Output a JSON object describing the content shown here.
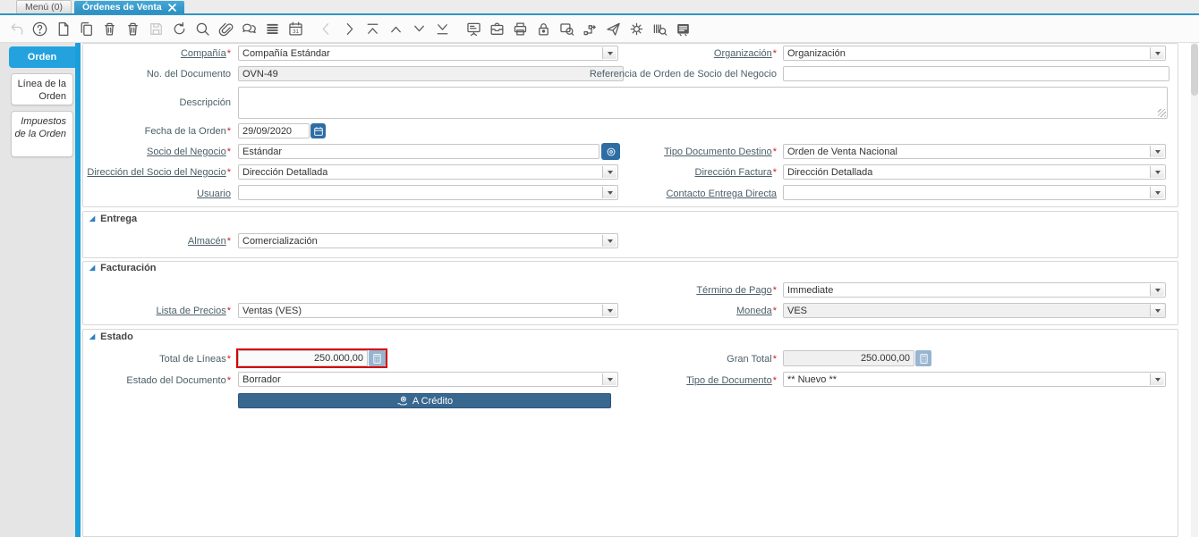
{
  "window": {
    "tab_menu": "Menú (0)",
    "tab_active": "Órdenes de Venta"
  },
  "toolbar": {
    "items": [
      {
        "name": "undo",
        "disabled": true
      },
      {
        "name": "help"
      },
      {
        "name": "new-record"
      },
      {
        "name": "copy-record"
      },
      {
        "name": "delete-record"
      },
      {
        "name": "delete-selection"
      },
      {
        "name": "save",
        "disabled": true
      },
      {
        "name": "refresh"
      },
      {
        "name": "find"
      },
      {
        "name": "attachment"
      },
      {
        "name": "chat"
      },
      {
        "name": "toggle-grid"
      },
      {
        "name": "calendar"
      },
      {
        "name": "previous-record",
        "disabled": true
      },
      {
        "name": "next-record"
      },
      {
        "name": "first-record"
      },
      {
        "name": "parent-record"
      },
      {
        "name": "detail-record"
      },
      {
        "name": "last-record"
      },
      {
        "name": "report"
      },
      {
        "name": "archive"
      },
      {
        "name": "print"
      },
      {
        "name": "lock"
      },
      {
        "name": "zoom-across"
      },
      {
        "name": "workflow"
      },
      {
        "name": "send-mail"
      },
      {
        "name": "preferences"
      },
      {
        "name": "product-info"
      },
      {
        "name": "window-report"
      }
    ]
  },
  "sidebar": {
    "tabs": [
      {
        "label": "Orden"
      },
      {
        "label": "Línea de la Orden"
      },
      {
        "label": "Impuestos de la Orden"
      }
    ]
  },
  "form": {
    "required_marker": "*",
    "sections": {
      "entrega": "Entrega",
      "facturacion": "Facturación",
      "estado": "Estado"
    },
    "fields": {
      "compania": {
        "label": "Compañía",
        "value": "Compañía Estándar"
      },
      "organizacion": {
        "label": "Organización",
        "value": "Organización"
      },
      "no_documento": {
        "label": "No. del Documento",
        "value": "OVN-49"
      },
      "referencia": {
        "label": "Referencia de Orden de Socio del Negocio",
        "value": ""
      },
      "descripcion": {
        "label": "Descripción",
        "value": ""
      },
      "fecha_orden": {
        "label": "Fecha de la Orden",
        "value": "29/09/2020"
      },
      "socio_negocio": {
        "label": "Socio del Negocio",
        "value": "Estándar"
      },
      "tipo_doc_destino": {
        "label": "Tipo Documento Destino",
        "value": "Orden de Venta Nacional"
      },
      "direccion_socio": {
        "label": "Dirección del Socio del Negocio",
        "value": "Dirección Detallada"
      },
      "direccion_factura": {
        "label": "Dirección Factura",
        "value": "Dirección Detallada"
      },
      "usuario": {
        "label": "Usuario",
        "value": ""
      },
      "contacto_entrega": {
        "label": "Contacto Entrega Directa",
        "value": ""
      },
      "almacen": {
        "label": "Almacén",
        "value": "Comercialización"
      },
      "termino_pago": {
        "label": "Término de Pago",
        "value": "Immediate"
      },
      "lista_precios": {
        "label": "Lista de Precios",
        "value": "Ventas (VES)"
      },
      "moneda": {
        "label": "Moneda",
        "value": "VES"
      },
      "total_lineas": {
        "label": "Total de Líneas",
        "value": "250.000,00"
      },
      "gran_total": {
        "label": "Gran Total",
        "value": "250.000,00"
      },
      "estado_documento": {
        "label": "Estado del Documento",
        "value": "Borrador"
      },
      "tipo_documento": {
        "label": "Tipo de Documento",
        "value": "** Nuevo **"
      }
    },
    "buttons": {
      "credito": "A Crédito"
    }
  },
  "colors": {
    "accent_blue": "#1b9fda",
    "tab_blue": "#3398c9",
    "action_button_blue": "#2e6da4",
    "credit_button_blue": "#38678f",
    "highlight_red": "#d40000"
  }
}
